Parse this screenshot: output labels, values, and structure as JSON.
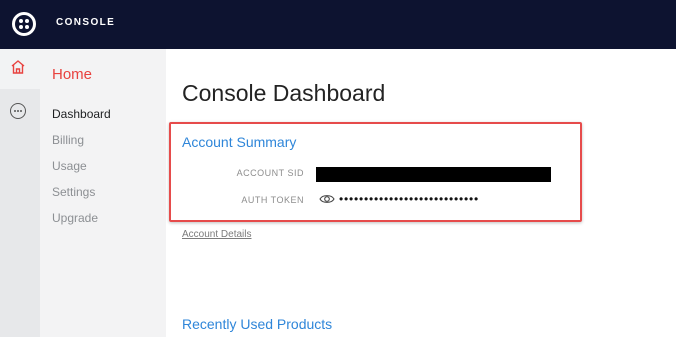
{
  "topbar": {
    "title": "CONSOLE"
  },
  "sidebar": {
    "header": "Home",
    "items": [
      {
        "label": "Dashboard",
        "active": true
      },
      {
        "label": "Billing",
        "active": false
      },
      {
        "label": "Usage",
        "active": false
      },
      {
        "label": "Settings",
        "active": false
      },
      {
        "label": "Upgrade",
        "active": false
      }
    ]
  },
  "main": {
    "title": "Console Dashboard",
    "account_summary": {
      "title": "Account Summary",
      "sid_label": "ACCOUNT SID",
      "token_label": "AUTH TOKEN",
      "token_masked": "••••••••••••••••••••••••••••",
      "details_link": "Account Details"
    },
    "recent_title": "Recently Used Products"
  },
  "colors": {
    "topbar": "#0d1330",
    "accent_red": "#e8423f",
    "link_blue": "#2f86d9",
    "highlight": "#e64b4b"
  },
  "icons": [
    "twilio-logo-icon",
    "home-icon",
    "more-icon",
    "eye-icon"
  ]
}
